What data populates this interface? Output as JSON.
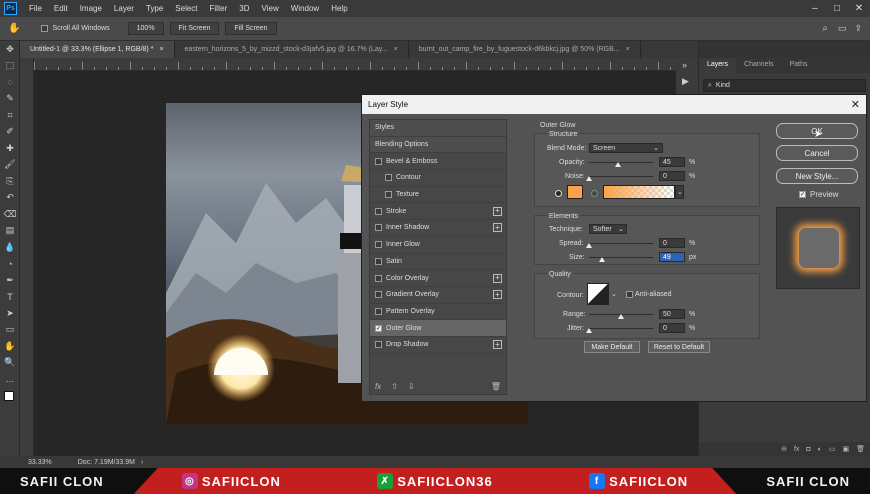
{
  "menubar": {
    "logo": "Ps",
    "items": [
      "File",
      "Edit",
      "Image",
      "Layer",
      "Type",
      "Select",
      "Filter",
      "3D",
      "View",
      "Window",
      "Help"
    ]
  },
  "options": {
    "scroll_all": "Scroll All Windows",
    "zoom": "100%",
    "fit": "Fit Screen",
    "fill": "Fill Screen"
  },
  "tabs": [
    "Untitled-1 @ 33.3% (Ellipse 1, RGB/8) *",
    "eastern_horizons_5_by_mizzd_stock-d3jafv5.jpg @ 16.7% (Lay...",
    "burnt_out_camp_fire_by_fuguestock-d6kbkcj.jpg @ 50% (RGB..."
  ],
  "status": {
    "zoom": "33.33%",
    "doc": "Doc: 7.19M/33.9M"
  },
  "panels": {
    "tabs": [
      "Layers",
      "Channels",
      "Paths"
    ],
    "kind": "Kind"
  },
  "dialog": {
    "title": "Layer Style",
    "style_items": [
      {
        "label": "Styles",
        "type": "hdr"
      },
      {
        "label": "Blending Options",
        "type": "hdr"
      },
      {
        "label": "Bevel & Emboss",
        "checked": false,
        "plus": false
      },
      {
        "label": "Contour",
        "checked": false,
        "plus": false,
        "indent": true
      },
      {
        "label": "Texture",
        "checked": false,
        "plus": false,
        "indent": true
      },
      {
        "label": "Stroke",
        "checked": false,
        "plus": true
      },
      {
        "label": "Inner Shadow",
        "checked": false,
        "plus": true
      },
      {
        "label": "Inner Glow",
        "checked": false,
        "plus": false
      },
      {
        "label": "Satin",
        "checked": false,
        "plus": false
      },
      {
        "label": "Color Overlay",
        "checked": false,
        "plus": true
      },
      {
        "label": "Gradient Overlay",
        "checked": false,
        "plus": true
      },
      {
        "label": "Pattern Overlay",
        "checked": false,
        "plus": false
      },
      {
        "label": "Outer Glow",
        "checked": true,
        "plus": false,
        "selected": true
      },
      {
        "label": "Drop Shadow",
        "checked": false,
        "plus": true
      }
    ],
    "fx": "fx",
    "outer_glow": {
      "title": "Outer Glow",
      "structure": "Structure",
      "blend_mode_label": "Blend Mode:",
      "blend_mode": "Screen",
      "opacity_label": "Opacity:",
      "opacity": "45",
      "opacity_pct": 45,
      "noise_label": "Noise:",
      "noise": "0",
      "noise_pct": 0,
      "glow_color": "#f8a24a",
      "elements": "Elements",
      "technique_label": "Technique:",
      "technique": "Softer",
      "spread_label": "Spread:",
      "spread": "0",
      "spread_pct": 0,
      "size_label": "Size:",
      "size": "49",
      "size_unit": "px",
      "size_pct": 20,
      "quality": "Quality",
      "contour_label": "Contour:",
      "anti_aliased": "Anti-aliased",
      "range_label": "Range:",
      "range": "50",
      "range_pct": 50,
      "jitter_label": "Jitter:",
      "jitter": "0",
      "jitter_pct": 0,
      "pct": "%",
      "make_default": "Make Default",
      "reset_default": "Reset to Default"
    },
    "ok": "OK",
    "cancel": "Cancel",
    "new_style": "New Style...",
    "preview": "Preview"
  },
  "banner": {
    "left": "SAFII CLON",
    "instagram": "SAFIICLON",
    "other": "SAFIICLON36",
    "facebook": "SAFIICLON",
    "right": "SAFII CLON"
  }
}
